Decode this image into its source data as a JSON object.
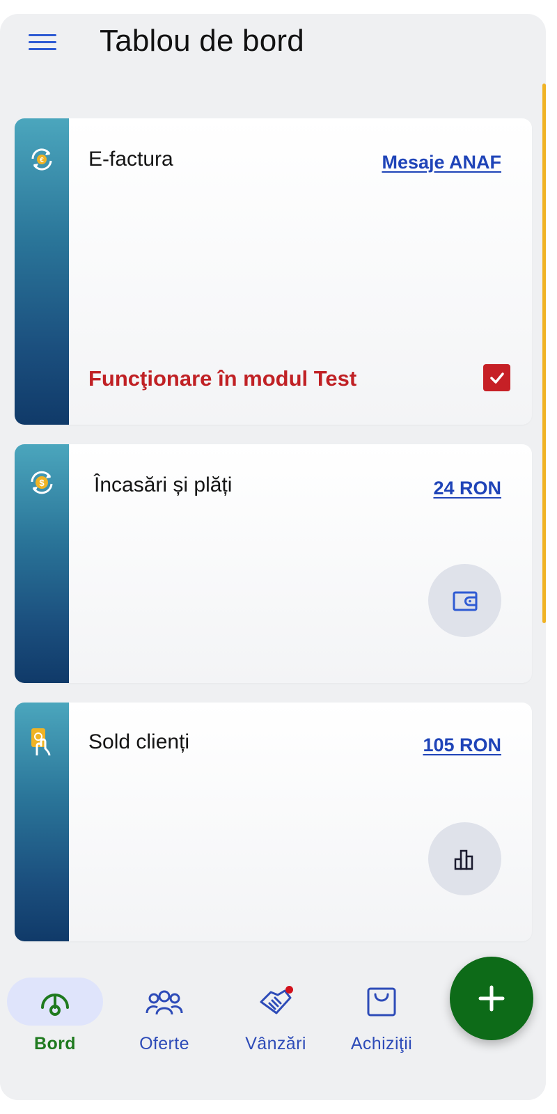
{
  "app_bar": {
    "title": "Tablou de bord"
  },
  "cards": [
    {
      "title": "E-factura",
      "link": "Mesaje ANAF",
      "test_mode_label": "Funcţionare în modul Test",
      "test_mode_checked": true
    },
    {
      "title": "Încasări și plăți",
      "link": "24 RON"
    },
    {
      "title": "Sold clienți",
      "link": "105 RON"
    }
  ],
  "bottom_nav": {
    "items": [
      {
        "label": "Bord",
        "active": true,
        "icon": "dashboard-gauge-icon"
      },
      {
        "label": "Oferte",
        "active": false,
        "icon": "people-group-icon"
      },
      {
        "label": "Vânzări",
        "active": false,
        "icon": "handshake-icon",
        "badge": true
      },
      {
        "label": "Achiziţii",
        "active": false,
        "icon": "shopping-bag-icon"
      }
    ]
  },
  "fab": {
    "icon": "plus-icon"
  },
  "colors": {
    "accent_blue": "#2f5bd3",
    "test_red": "#c62026",
    "active_green": "#1f7a1f",
    "fab_green": "#0d6b18",
    "scroll_accent": "#f0b324"
  }
}
